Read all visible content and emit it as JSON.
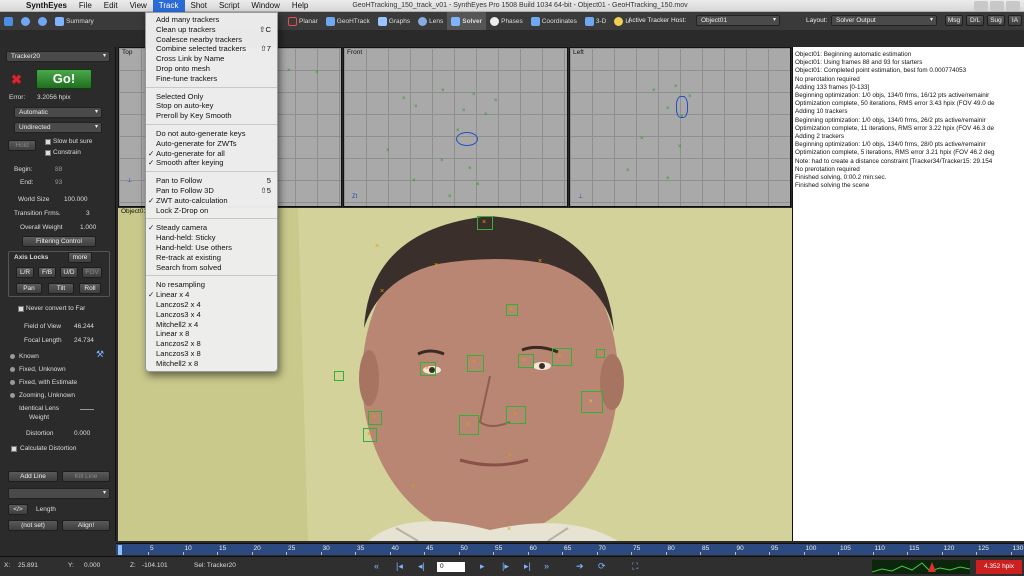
{
  "menubar": {
    "items": [
      "SynthEyes",
      "File",
      "Edit",
      "View",
      "Track",
      "Shot",
      "Script",
      "Window",
      "Help"
    ],
    "window_title": "GeoHTracking_150_track_v01 - SynthEyes Pro 1508 Build 1034 64-bit - Object01 - GeoHTracking_150.mov"
  },
  "tabs": {
    "left": [
      "Summary"
    ],
    "right": [
      "Planar",
      "GeoHTrack",
      "Graphs",
      "Lens",
      "Solver",
      "Phases",
      "Coordinates",
      "3-D",
      "Li"
    ]
  },
  "toolbar": {
    "active_tracker_host_label": "Active Tracker Host:",
    "active_tracker_host_value": "Object01",
    "layout_label": "Layout:",
    "layout_value": "Solver Output",
    "buttons": [
      "Msg",
      "D/L",
      "Sug",
      "IA"
    ]
  },
  "left_panel": {
    "tracker": "Tracker20",
    "go_label": "Go!",
    "error_label": "Error:",
    "error_value": "3.2056 hpix",
    "mode": "Automatic",
    "direction": "Undirected",
    "hold_label": "Hold",
    "slow_but_sure": "Slow but sure",
    "constrain": "Constrain",
    "begin_label": "Begin:",
    "begin_value": "88",
    "end_label": "End:",
    "end_value": "93",
    "world_size_label": "World Size",
    "world_size_value": "100.000",
    "transition_frms_label": "Transition Frms.",
    "transition_frms_value": "3",
    "overall_weight_label": "Overall Weight",
    "overall_weight_value": "1.000",
    "filtering_control": "Filtering Control",
    "axis_locks_label": "Axis Locks",
    "more_label": "more",
    "axis_buttons": [
      "L/R",
      "F/B",
      "U/D",
      "FOV"
    ],
    "axis_buttons2": [
      "Pan",
      "Tilt",
      "Roll"
    ],
    "never_convert": "Never convert to Far",
    "fov_label": "Field of View",
    "fov_value": "46.244",
    "focal_label": "Focal Length",
    "focal_value": "24.734",
    "lens_modes": [
      "Known",
      "Fixed, Unknown",
      "Fixed, with Estimate",
      "Zooming, Unknown"
    ],
    "identical_lens_weight": "Identical Lens Weight",
    "distortion_label": "Distortion",
    "distortion_value": "0.000",
    "calculate_distortion": "Calculate Distortion",
    "add_line": "Add Line",
    "kill_line": "Kill Line",
    "length_label": "Length",
    "not_set": "(not set)",
    "align": "Align!"
  },
  "viewports": {
    "top": "Top",
    "front": "Front",
    "left": "Left",
    "camera": "Object01"
  },
  "track_menu": {
    "items": [
      {
        "label": "Add many trackers",
        "shortcut": "",
        "checked": false
      },
      {
        "label": "Clean up trackers",
        "shortcut": "⇧C",
        "checked": false
      },
      {
        "label": "Coalesce nearby trackers",
        "shortcut": "",
        "checked": false
      },
      {
        "label": "Combine selected trackers",
        "shortcut": "⇧7",
        "checked": false
      },
      {
        "label": "Cross Link by Name",
        "shortcut": "",
        "checked": false
      },
      {
        "label": "Drop onto mesh",
        "shortcut": "",
        "checked": false
      },
      {
        "label": "Fine-tune trackers",
        "shortcut": "",
        "checked": false
      },
      {
        "label": "Selected Only",
        "shortcut": "",
        "checked": false
      },
      {
        "label": "Stop on auto-key",
        "shortcut": "",
        "checked": false
      },
      {
        "label": "Preroll by Key Smooth",
        "shortcut": "",
        "checked": false
      },
      {
        "label": "Do not auto-generate keys",
        "shortcut": "",
        "checked": false
      },
      {
        "label": "Auto-generate for ZWTs",
        "shortcut": "",
        "checked": false
      },
      {
        "label": "Auto-generate for all",
        "shortcut": "",
        "checked": true
      },
      {
        "label": "Smooth after keying",
        "shortcut": "",
        "checked": true
      },
      {
        "label": "Pan to Follow",
        "shortcut": "5",
        "checked": false
      },
      {
        "label": "Pan to Follow 3D",
        "shortcut": "⇧5",
        "checked": false
      },
      {
        "label": "ZWT auto-calculation",
        "shortcut": "",
        "checked": true
      },
      {
        "label": "Lock Z-Drop on",
        "shortcut": "",
        "checked": false
      },
      {
        "label": "Steady camera",
        "shortcut": "",
        "checked": true
      },
      {
        "label": "Hand-held: Sticky",
        "shortcut": "",
        "checked": false
      },
      {
        "label": "Hand-held: Use others",
        "shortcut": "",
        "checked": false
      },
      {
        "label": "Re-track at existing",
        "shortcut": "",
        "checked": false
      },
      {
        "label": "Search from solved",
        "shortcut": "",
        "checked": false
      },
      {
        "label": "No resampling",
        "shortcut": "",
        "checked": false
      },
      {
        "label": "Linear x 4",
        "shortcut": "",
        "checked": true
      },
      {
        "label": "Lanczos2 x 4",
        "shortcut": "",
        "checked": false
      },
      {
        "label": "Lanczos3 x 4",
        "shortcut": "",
        "checked": false
      },
      {
        "label": "Mitchell2 x 4",
        "shortcut": "",
        "checked": false
      },
      {
        "label": "Linear x 8",
        "shortcut": "",
        "checked": false
      },
      {
        "label": "Lanczos2 x 8",
        "shortcut": "",
        "checked": false
      },
      {
        "label": "Lanczos3 x 8",
        "shortcut": "",
        "checked": false
      },
      {
        "label": "Mitchell2 x 8",
        "shortcut": "",
        "checked": false
      }
    ]
  },
  "log": [
    "Object01: Beginning automatic estimation",
    "Object01: Using frames 88 and 93 for starters",
    "Object01: Completed point estimation, best fom 0.000774053",
    "No prerotation required",
    "Adding 133 frames [0-133]",
    "Beginning optimization: 1/0 objs, 134/0 frms, 16/12 pts active/remainir",
    "Optimization complete, 50 iterations, RMS error 3.43 hpix (FOV 49.0 de",
    "Adding 10 trackers",
    "Beginning optimization: 1/0 objs, 134/0 frms, 26/2 pts active/remainir",
    "Optimization complete, 11 iterations, RMS error 3.22 hpix (FOV 46.3 de",
    "Adding 2 trackers",
    "Beginning optimization: 1/0 objs, 134/0 frms, 28/0 pts active/remainir",
    "Optimization complete, 5 iterations, RMS error 3.21 hpix (FOV 46.2 deg",
    "Note: had to create a distance constraint [Tracker34/Tracker15: 29.154",
    "No prerotation required",
    "Finished solving, 0:00.2 min:sec.",
    "Finished solving the scene"
  ],
  "timeline": {
    "ticks": [
      "5",
      "10",
      "15",
      "20",
      "25",
      "30",
      "35",
      "40",
      "45",
      "50",
      "55",
      "60",
      "65",
      "70",
      "75",
      "80",
      "85",
      "90",
      "95",
      "100",
      "105",
      "110",
      "115",
      "120",
      "125",
      "130"
    ]
  },
  "statusbar": {
    "x_label": "X:",
    "x_value": "25.891",
    "y_label": "Y:",
    "y_value": "0.000",
    "z_label": "Z:",
    "z_value": "-104.101",
    "sel_label": "Sel: Tracker20",
    "frame_value": "0",
    "error_display": "4.352 hpix"
  },
  "colors": {
    "tracker_green": "#32b232",
    "solver_accent": "#2a6bd6",
    "error_red": "#cc2020"
  }
}
